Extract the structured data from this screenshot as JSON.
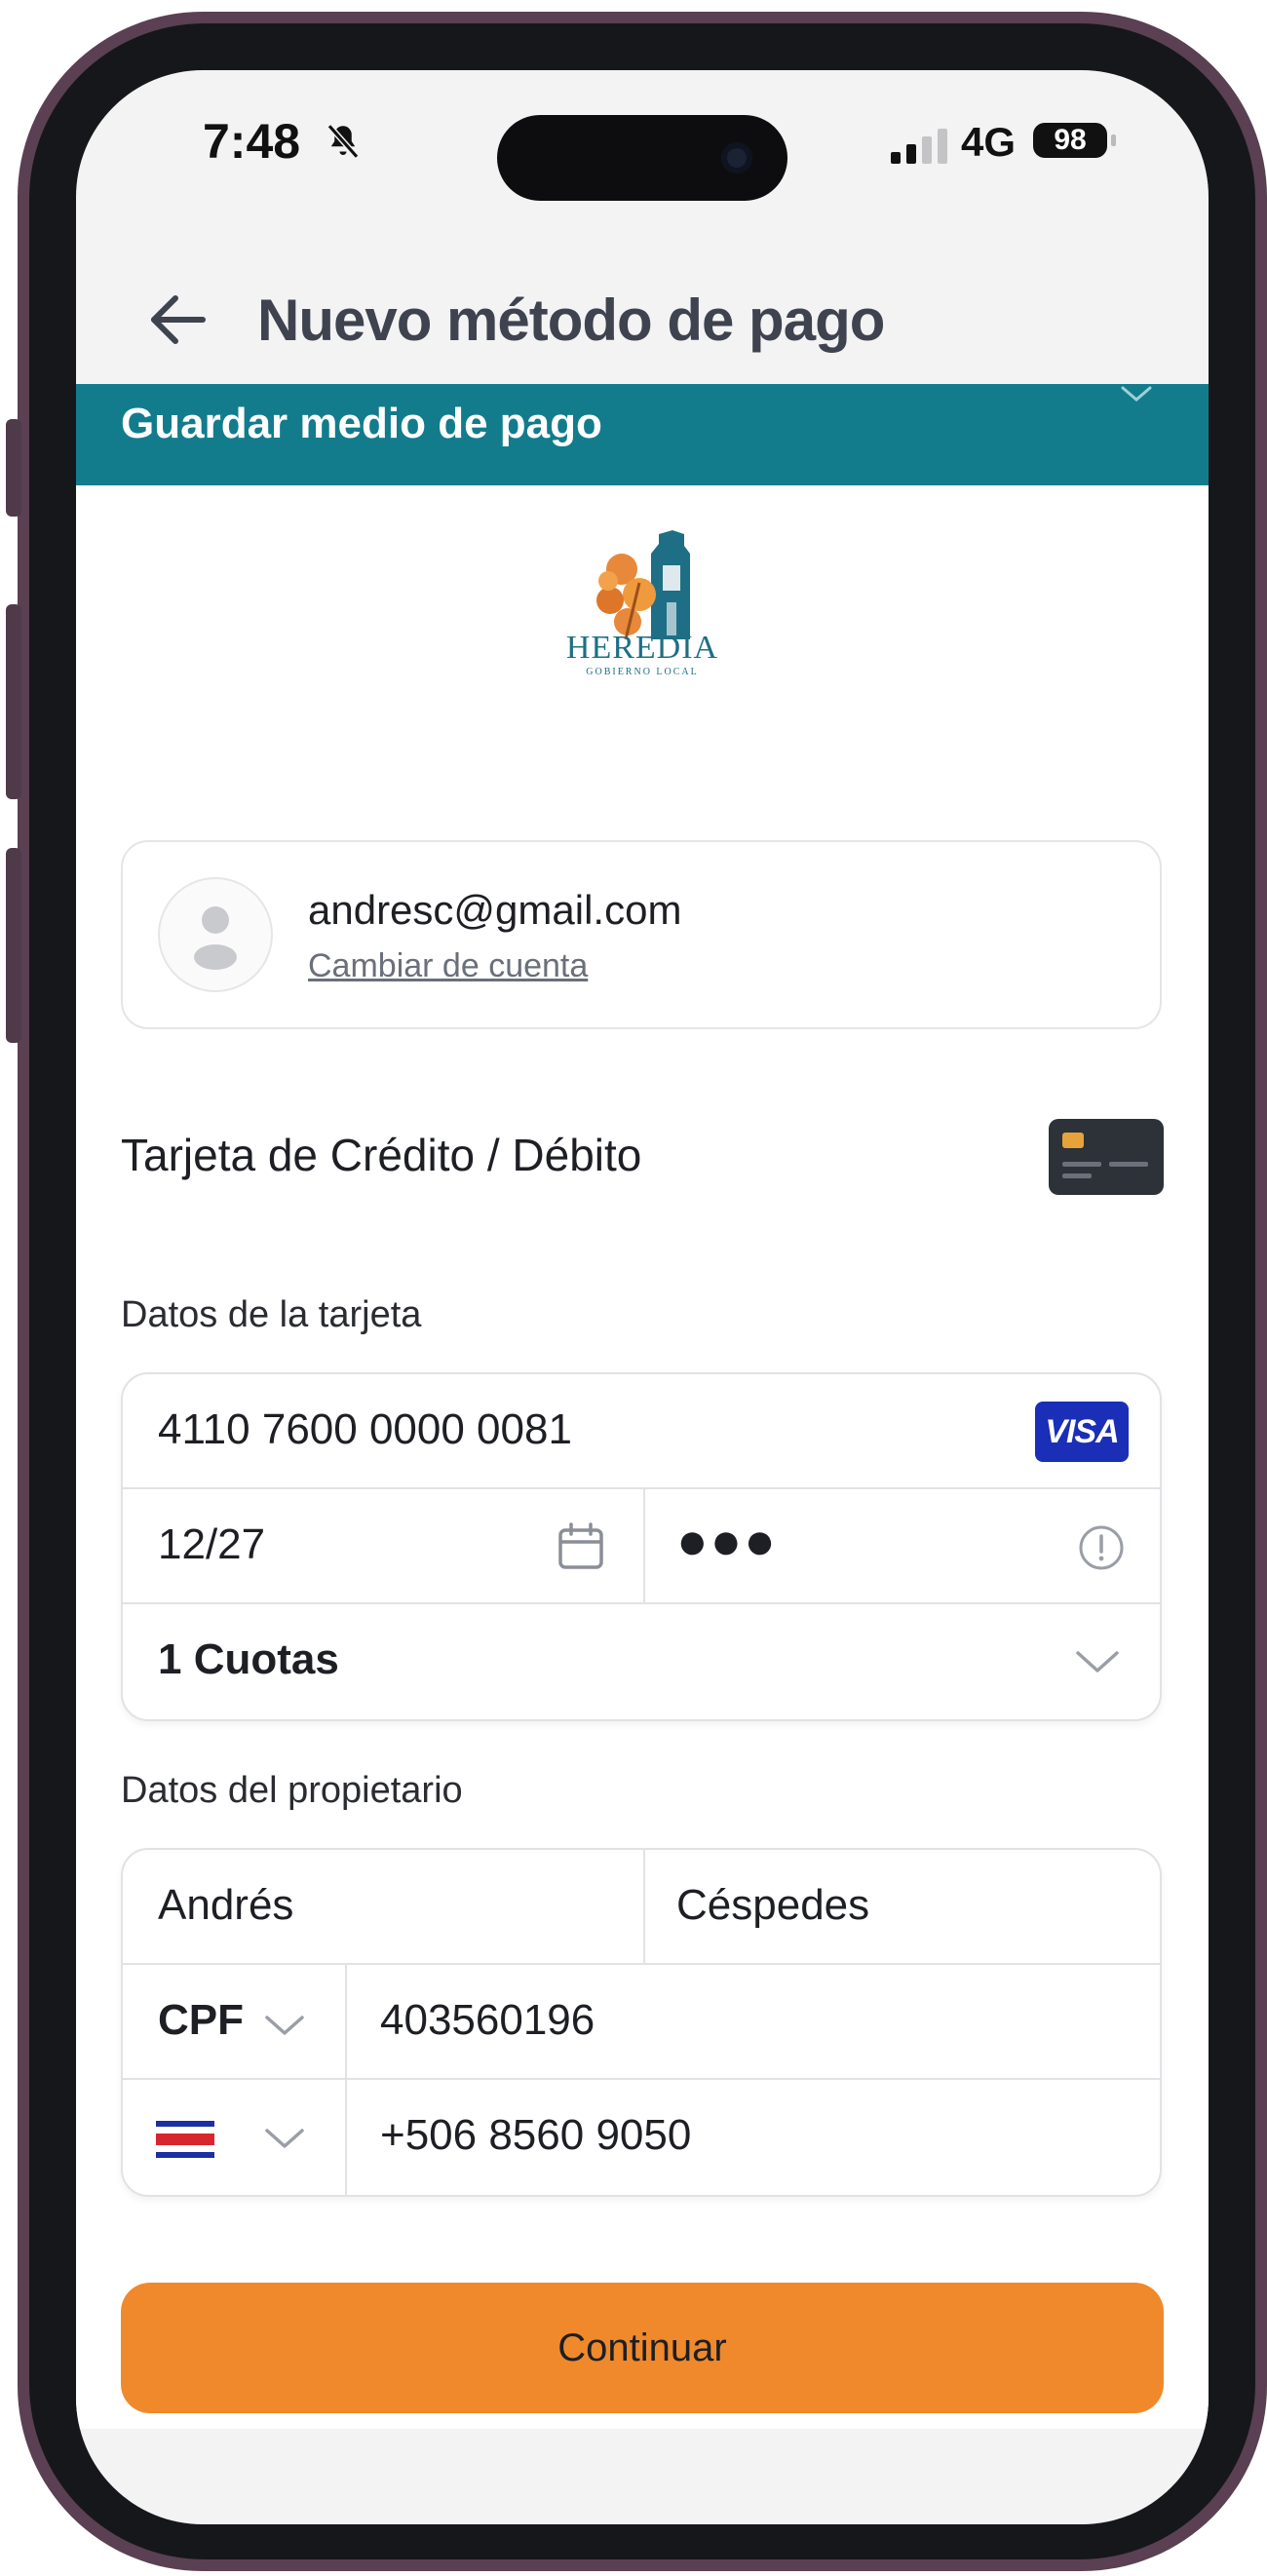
{
  "status_bar": {
    "time": "7:48",
    "network": "4G",
    "battery": "98"
  },
  "header": {
    "title": "Nuevo método de pago"
  },
  "banner": {
    "text": "Guardar medio de pago"
  },
  "logo": {
    "name": "HEREDIA",
    "subtitle": "GOBIERNO LOCAL"
  },
  "account": {
    "email": "andresc@gmail.com",
    "change_link": "Cambiar de cuenta"
  },
  "payment_method": {
    "label": "Tarjeta de Crédito / Débito"
  },
  "card_section": {
    "label": "Datos de la tarjeta",
    "card_number": "4110 7600 0000 0081",
    "card_brand": "VISA",
    "expiry": "12/27",
    "cvv": "●●●",
    "installments": "1 Cuotas"
  },
  "owner_section": {
    "label": "Datos del propietario",
    "first_name": "Andrés",
    "last_name": "Céspedes",
    "doc_type": "CPF",
    "doc_number": "403560196",
    "phone": "+506 8560 9050"
  },
  "actions": {
    "continue_label": "Continuar"
  },
  "colors": {
    "banner": "#127c8d",
    "primary_button": "#f0892b",
    "visa_blue": "#1a2eb8",
    "frame": "#5a4052"
  }
}
